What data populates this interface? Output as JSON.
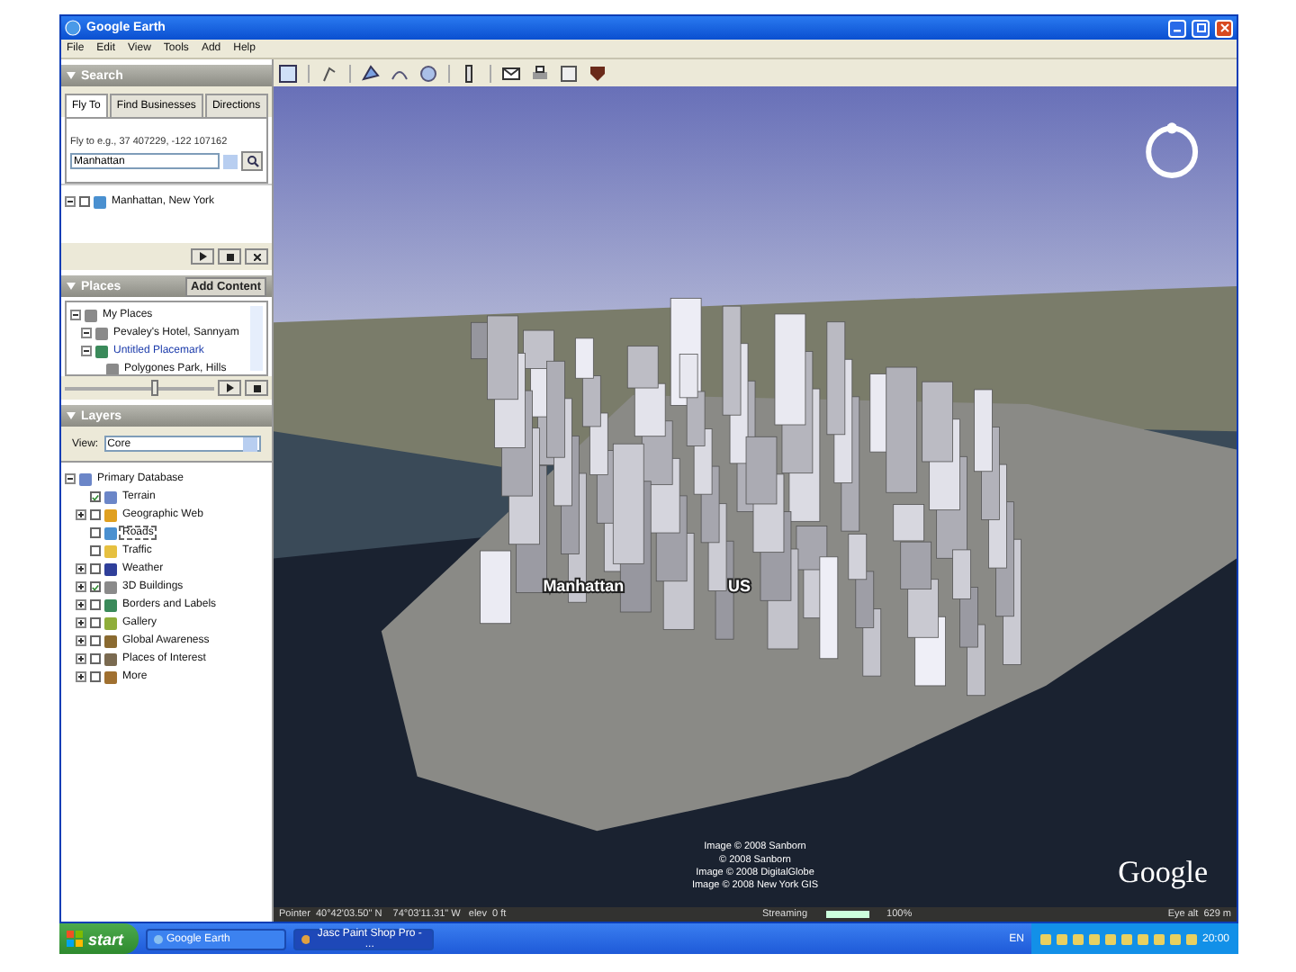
{
  "window": {
    "title": "Google Earth"
  },
  "menu": [
    "File",
    "Edit",
    "View",
    "Tools",
    "Add",
    "Help"
  ],
  "search": {
    "title": "Search",
    "tabs": [
      {
        "label": "Fly To",
        "selected": true
      },
      {
        "label": "Find Businesses",
        "selected": false
      },
      {
        "label": "Directions",
        "selected": false
      }
    ],
    "hint": "Fly to e.g., 37 407229, -122 107162",
    "query": "Manhattan",
    "results": [
      {
        "label": "Manhattan, New York",
        "expanded": true,
        "checked": false
      }
    ]
  },
  "places": {
    "title": "Places",
    "add_button": "Add Content",
    "items": [
      {
        "label": "My Places",
        "expanded": true,
        "children": [
          {
            "label": "Pevaley's Hotel, Sannyam",
            "expanded": true
          },
          {
            "label": "Untitled Placemark",
            "expanded": true,
            "link": true,
            "children": [
              {
                "label": "Polygones Park, Hills"
              }
            ]
          }
        ]
      }
    ],
    "slider": {
      "level": 0.6
    }
  },
  "layers": {
    "title": "Layers",
    "view_label": "View:",
    "view_value": "Core",
    "items": [
      {
        "label": "Primary Database",
        "expanded": true,
        "children": [
          {
            "label": "Terrain",
            "checked": true,
            "selected": false
          },
          {
            "label": "Geographic Web",
            "expanded": false,
            "checked": false,
            "selected": false
          },
          {
            "label": "Roads",
            "checked": false,
            "selected": true
          },
          {
            "label": "Traffic",
            "checked": false,
            "selected": false
          },
          {
            "label": "Weather",
            "expanded": false,
            "checked": false,
            "selected": false
          },
          {
            "label": "3D Buildings",
            "expanded": false,
            "checked": true,
            "selected": false
          },
          {
            "label": "Borders and Labels",
            "expanded": false,
            "checked": false,
            "selected": false
          },
          {
            "label": "Gallery",
            "expanded": false,
            "checked": false,
            "selected": false
          },
          {
            "label": "Global Awareness",
            "expanded": false,
            "checked": false,
            "selected": false
          },
          {
            "label": "Places of Interest",
            "expanded": false,
            "checked": false,
            "selected": false
          },
          {
            "label": "More",
            "expanded": false,
            "checked": false,
            "selected": false
          }
        ]
      }
    ]
  },
  "map": {
    "label": "Manhattan",
    "label_2": "US",
    "attributions": [
      "Image © 2008 Sanborn",
      "© 2008 Sanborn",
      "Image © 2008 DigitalGlobe",
      "Image © 2008 New York GIS"
    ],
    "logo": "Google"
  },
  "status_bar": {
    "pointer": "Pointer  40°42'03.50\" N    74°03'11.31\" W   elev  0 ft",
    "streaming": "Streaming",
    "level": 1,
    "reading": "100%",
    "eye_alt": "Eye alt  629 m"
  },
  "taskbar": {
    "start": "start",
    "tasks": [
      {
        "label": "Google Earth",
        "selected": false
      },
      {
        "label": "Jasc Paint Shop Pro - ...",
        "selected": true
      }
    ],
    "language": "EN",
    "clock": "20:00"
  }
}
